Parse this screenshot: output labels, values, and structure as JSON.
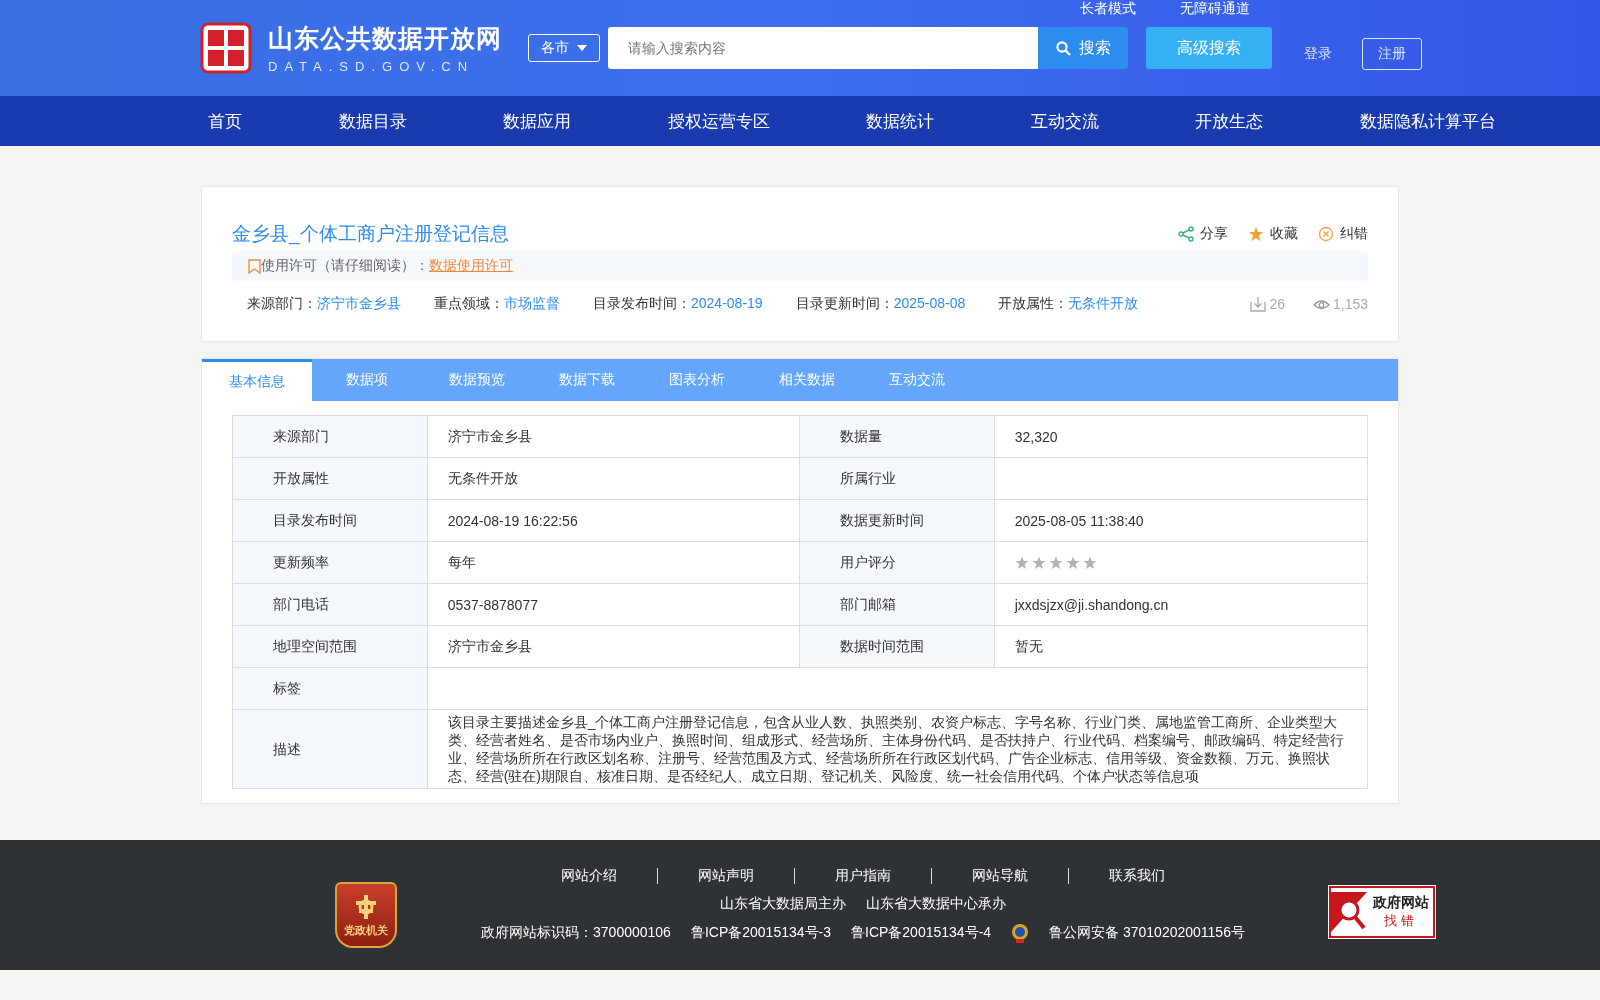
{
  "header": {
    "site_title": "山东公共数据开放网",
    "site_domain": "DATA.SD.GOV.CN",
    "top_links": [
      "长者模式",
      "无障碍通道"
    ],
    "city_select": "各市",
    "search": {
      "placeholder": "请输入搜索内容",
      "button": "搜索"
    },
    "advanced_search": "高级搜索",
    "login": "登录",
    "register": "注册"
  },
  "nav": [
    {
      "label": "首页",
      "selected": false
    },
    {
      "label": "数据目录",
      "selected": false
    },
    {
      "label": "数据应用",
      "selected": false
    },
    {
      "label": "授权运营专区",
      "selected": false
    },
    {
      "label": "数据统计",
      "selected": false
    },
    {
      "label": "互动交流",
      "selected": false
    },
    {
      "label": "开放生态",
      "selected": false
    },
    {
      "label": "数据隐私计算平台",
      "selected": false
    }
  ],
  "dataset": {
    "title": "金乡县_个体工商户注册登记信息",
    "actions": [
      {
        "kind": "share",
        "label": "分享"
      },
      {
        "kind": "favorite",
        "label": "收藏"
      },
      {
        "kind": "report",
        "label": "纠错"
      }
    ],
    "license": {
      "text": "使用许可（请仔细阅读）：",
      "link": "数据使用许可"
    },
    "meta": [
      {
        "label": "来源部门：",
        "value": "济宁市金乡县"
      },
      {
        "label": "重点领域：",
        "value": "市场监督"
      },
      {
        "label": "目录发布时间：",
        "value": "2024-08-19"
      },
      {
        "label": "目录更新时间：",
        "value": "2025-08-08"
      },
      {
        "label": "开放属性：",
        "value": "无条件开放"
      }
    ],
    "downloads": "26",
    "views": "1,153"
  },
  "tabs": [
    {
      "label": "基本信息",
      "selected": true
    },
    {
      "label": "数据项",
      "selected": false
    },
    {
      "label": "数据预览",
      "selected": false
    },
    {
      "label": "数据下载",
      "selected": false
    },
    {
      "label": "图表分析",
      "selected": false
    },
    {
      "label": "相关数据",
      "selected": false
    },
    {
      "label": "互动交流",
      "selected": false
    }
  ],
  "info_rows": [
    {
      "cells": [
        {
          "label": "来源部门",
          "value": "济宁市金乡县"
        },
        {
          "label": "数据量",
          "value": "32,320"
        }
      ]
    },
    {
      "cells": [
        {
          "label": "开放属性",
          "value": "无条件开放"
        },
        {
          "label": "所属行业"
        }
      ]
    },
    {
      "cells": [
        {
          "label": "目录发布时间",
          "value": "2024-08-19 16:22:56"
        },
        {
          "label": "数据更新时间",
          "value": "2025-08-05 11:38:40"
        }
      ]
    },
    {
      "cells": [
        {
          "label": "更新频率",
          "value": "每年"
        },
        {
          "label": "用户评分",
          "stars": 0
        }
      ]
    },
    {
      "cells": [
        {
          "label": "部门电话",
          "value": "0537-8878077"
        },
        {
          "label": "部门邮箱",
          "value": "jxxdsjzx@ji.shandong.cn"
        }
      ]
    },
    {
      "cells": [
        {
          "label": "地理空间范围",
          "value": "济宁市金乡县"
        },
        {
          "label": "数据时间范围",
          "value": "暂无"
        }
      ]
    },
    {
      "cells": [
        {
          "label": "标签"
        }
      ]
    },
    {
      "cells": [
        {
          "label": "描述",
          "value": "该目录主要描述金乡县_个体工商户注册登记信息，包含从业人数、执照类别、农资户标志、字号名称、行业门类、属地监管工商所、企业类型大类、经营者姓名、是否市场内业户、换照时间、组成形式、经营场所、主体身份代码、是否扶持户、行业代码、档案编号、邮政编码、特定经营行业、经营场所所在行政区划名称、注册号、经营范围及方式、经营场所所在行政区划代码、广告企业标志、信用等级、资金数额、万元、换照状态、经营(驻在)期限自、核准日期、是否经纪人、成立日期、登记机关、风险度、统一社会信用代码、个体户状态等信息项"
        }
      ]
    }
  ],
  "footer": {
    "links": [
      "网站介绍",
      "网站声明",
      "用户指南",
      "网站导航",
      "联系我们"
    ],
    "sponsors": [
      "山东省大数据局主办",
      "山东省大数据中心承办"
    ],
    "records": [
      "政府网站标识码：3700000106",
      "鲁ICP备20015134号-3",
      "鲁ICP备20015134号-4",
      "鲁公网安备 37010202001156号"
    ],
    "badge_text": "党政机关",
    "error_badge": {
      "line1": "政府网站",
      "line2": "找错"
    }
  }
}
